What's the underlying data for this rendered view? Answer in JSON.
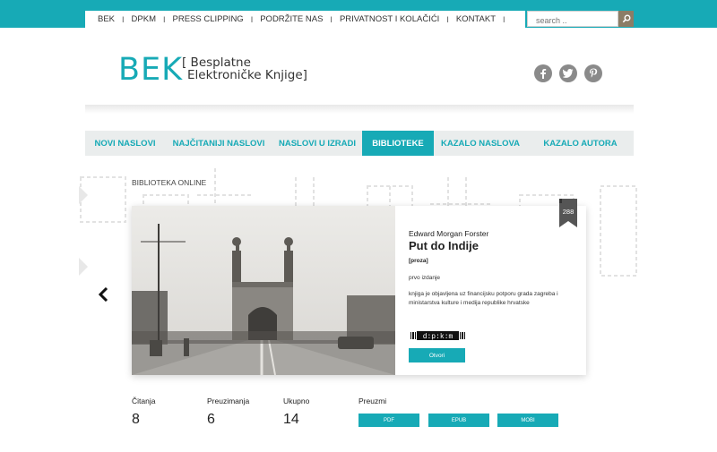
{
  "topnav": {
    "items": [
      "BEK",
      "DPKM",
      "PRESS CLIPPING",
      "PODRŽITE NAS",
      "PRIVATNOST I KOLAČIĆI",
      "KONTAKT"
    ],
    "separator": "I"
  },
  "search": {
    "placeholder": "search ..",
    "button_icon": "search-icon"
  },
  "logo": {
    "main": "BEK",
    "sub_line1": "[ Besplatne",
    "sub_line2": "Elektroničke Knjige]"
  },
  "social": {
    "icons": [
      "facebook-icon",
      "twitter-icon",
      "pinterest-icon"
    ]
  },
  "mainnav": {
    "items": [
      "NOVI NASLOVI",
      "NAJČITANIJI NASLOVI",
      "NASLOVI U IZRADI",
      "BIBLIOTEKE",
      "KAZALO NASLOVA",
      "KAZALO AUTORA"
    ],
    "active": "BIBLIOTEKE"
  },
  "section": {
    "title": "BIBLIOTEKA ONLINE"
  },
  "book": {
    "badge_number": "288",
    "author": "Edward Morgan Forster",
    "title": "Put do Indije",
    "genre": "[proza]",
    "edition": "prvo izdanje",
    "description": "knjiga je objavljena uz financijsku potporu grada zagreba i ministarstva kulture i medija republike hrvatske",
    "publisher_logo": "d:p:k:m",
    "open_button": "Otvori"
  },
  "stats": {
    "reads_label": "Čitanja",
    "reads_value": "8",
    "downloads_label": "Preuzimanja",
    "downloads_value": "6",
    "total_label": "Ukupno",
    "total_value": "14",
    "download_label": "Preuzmi"
  },
  "download_formats": [
    "PDF",
    "EPUB",
    "MOBI"
  ],
  "colors": {
    "accent": "#17aab6",
    "nav_bg": "#eaeded",
    "search_button": "#8b7d66",
    "social_icon": "#8a8a8a",
    "ribbon": "#555555"
  }
}
